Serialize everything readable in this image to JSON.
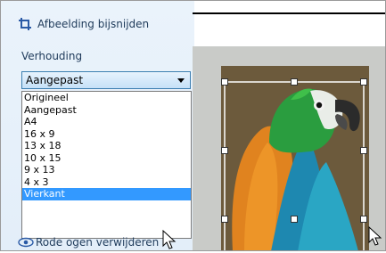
{
  "panel": {
    "title": "Afbeelding bijsnijden",
    "title_icon": "crop-icon",
    "ratio_label": "Verhouding"
  },
  "select": {
    "value": "Aangepast"
  },
  "dropdown": {
    "options": [
      "Origineel",
      "Aangepast",
      "A4",
      "16 x 9",
      "13 x 18",
      "10 x 15",
      "9 x 13",
      "4 x 3",
      "Vierkant"
    ],
    "highlighted": "Vierkant"
  },
  "next_item": {
    "label": "Rode ogen verwijderen",
    "icon": "eye-icon"
  },
  "colors": {
    "panel_bg": "#e3eef9",
    "select_border": "#3c7fb1",
    "highlight": "#3399ff"
  }
}
